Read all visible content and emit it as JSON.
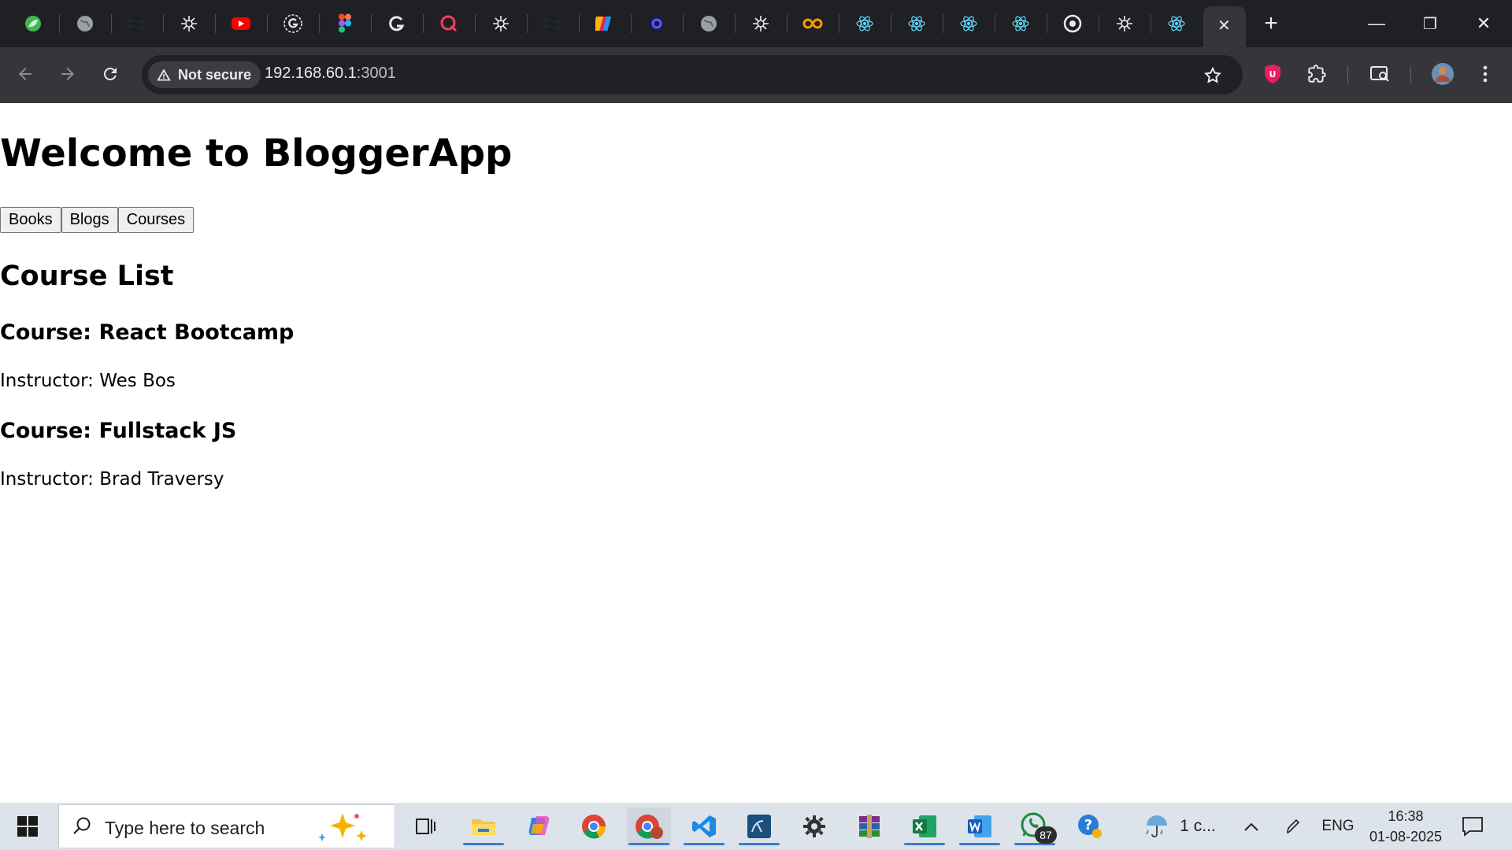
{
  "browser": {
    "tabs": [
      {
        "icon": "leaf-icon",
        "color": "#3fb950"
      },
      {
        "icon": "globe-icon",
        "color": "#9aa0a6"
      },
      {
        "icon": "tailwind-icon",
        "color": "#38bdf8"
      },
      {
        "icon": "openai-icon",
        "color": "#e8eaed"
      },
      {
        "icon": "youtube-icon",
        "color": "#ff0000"
      },
      {
        "icon": "circle-g-icon",
        "color": "#e8eaed"
      },
      {
        "icon": "figma-icon",
        "color": "#f24e1e"
      },
      {
        "icon": "g-logo-icon",
        "color": "#e8eaed"
      },
      {
        "icon": "q-icon",
        "color": "#ff3b5c"
      },
      {
        "icon": "openai-icon",
        "color": "#e8eaed"
      },
      {
        "icon": "tailwind-icon",
        "color": "#38bdf8"
      },
      {
        "icon": "multicolor-icon",
        "color": "#ffb400"
      },
      {
        "icon": "c-logo-icon",
        "color": "#5b5bf0"
      },
      {
        "icon": "globe-icon",
        "color": "#9aa0a6"
      },
      {
        "icon": "openai-icon",
        "color": "#e8eaed"
      },
      {
        "icon": "infinity-icon",
        "color": "#ff9900"
      },
      {
        "icon": "react-icon",
        "color": "#61dafb"
      },
      {
        "icon": "react-icon",
        "color": "#61dafb"
      },
      {
        "icon": "react-icon",
        "color": "#61dafb"
      },
      {
        "icon": "react-icon",
        "color": "#61dafb"
      },
      {
        "icon": "chrome-icon",
        "color": "#e8eaed"
      },
      {
        "icon": "openai-icon",
        "color": "#e8eaed"
      },
      {
        "icon": "react-icon",
        "color": "#61dafb"
      }
    ],
    "active_tab": {
      "icon": "close-icon",
      "label": "✕"
    },
    "new_tab_label": "+",
    "window_controls": {
      "minimize": "—",
      "restore": "❐",
      "close": "✕"
    },
    "omnibox": {
      "security_label": "Not secure",
      "url_host": "192.168.60.1",
      "url_port": ":3001"
    }
  },
  "page": {
    "title": "Welcome to BloggerApp",
    "buttons": [
      "Books",
      "Blogs",
      "Courses"
    ],
    "section_title": "Course List",
    "courses": [
      {
        "heading": "Course: React Bootcamp",
        "instructor": "Instructor: Wes Bos"
      },
      {
        "heading": "Course: Fullstack JS",
        "instructor": "Instructor: Brad Traversy"
      }
    ]
  },
  "taskbar": {
    "search_placeholder": "Type here to search",
    "whatsapp_badge": "87",
    "weather": "1 c...",
    "language": "ENG",
    "time": "16:38",
    "date": "01-08-2025"
  }
}
